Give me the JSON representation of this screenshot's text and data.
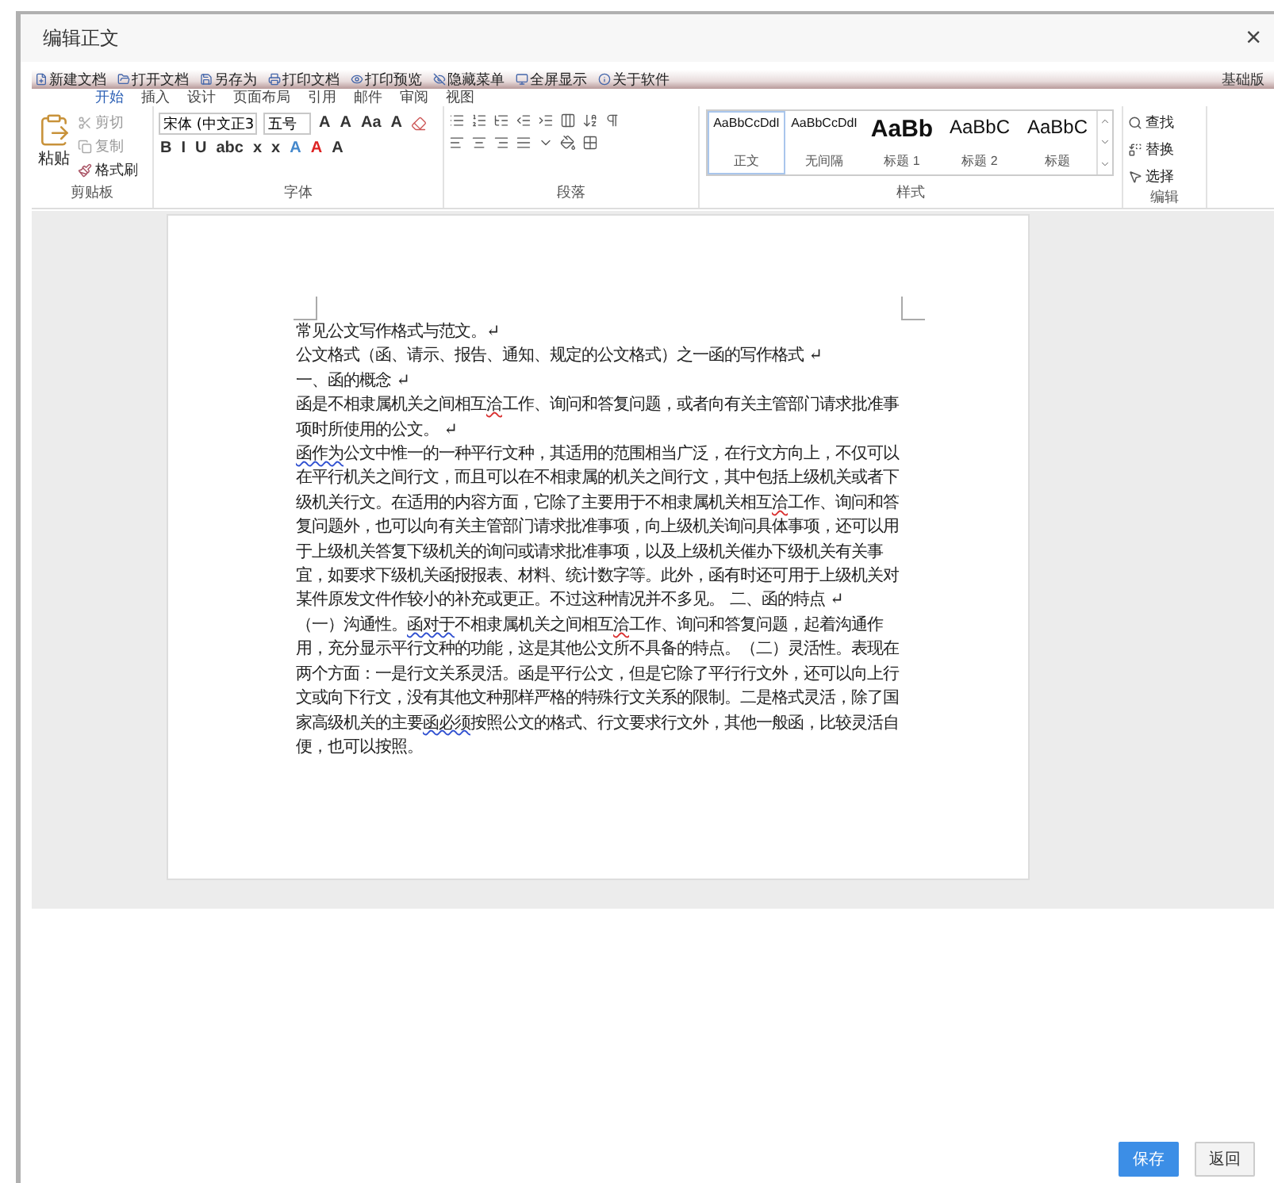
{
  "dialog": {
    "title": "编辑正文",
    "close": "×"
  },
  "quick_toolbar": {
    "items": [
      "新建文档",
      "打开文档",
      "另存为",
      "打印文档",
      "打印预览",
      "隐藏菜单",
      "全屏显示",
      "关于软件"
    ],
    "edition": "基础版"
  },
  "tabs": [
    {
      "label": "开始",
      "selected": true
    },
    {
      "label": "插入",
      "selected": false
    },
    {
      "label": "设计",
      "selected": false
    },
    {
      "label": "页面布局",
      "selected": false
    },
    {
      "label": "引用",
      "selected": false
    },
    {
      "label": "邮件",
      "selected": false
    },
    {
      "label": "审阅",
      "selected": false
    },
    {
      "label": "视图",
      "selected": false
    }
  ],
  "clipboard": {
    "paste": "粘贴",
    "items": [
      {
        "label": "剪切",
        "kind": "cut",
        "disabled": true
      },
      {
        "label": "复制",
        "kind": "copy",
        "disabled": true
      },
      {
        "label": "格式刷",
        "kind": "painter",
        "disabled": false
      }
    ],
    "label": "剪贴板"
  },
  "font": {
    "name": "宋体 (中文正3",
    "size": "五号",
    "row1": [
      "A",
      "A",
      "Aa",
      "A"
    ],
    "row2": [
      "B",
      "I",
      "U",
      "abc",
      "x",
      "x",
      "A",
      "A",
      "A"
    ],
    "label": "字体"
  },
  "paragraph": {
    "label": "段落"
  },
  "styles": {
    "items": [
      {
        "preview": "AaBbCcDdI",
        "name": "正文",
        "kind": "small",
        "selected": true
      },
      {
        "preview": "AaBbCcDdI",
        "name": "无间隔",
        "kind": "small",
        "selected": false
      },
      {
        "preview": "AaBb",
        "name": "标题 1",
        "kind": "heavy",
        "selected": false
      },
      {
        "preview": "AaBbC",
        "name": "标题 2",
        "kind": "medium",
        "selected": false
      },
      {
        "preview": "AaBbC",
        "name": "标题",
        "kind": "medium",
        "selected": false
      }
    ],
    "label": "样式"
  },
  "editing": {
    "items": [
      {
        "label": "查找",
        "kind": "find"
      },
      {
        "label": "替换",
        "kind": "replace"
      },
      {
        "label": "选择",
        "kind": "select"
      }
    ],
    "label": "编辑"
  },
  "document": {
    "paragraphs": [
      [
        {
          "text": "常见公文写作格式与范文。↵",
          "spelling_error": false,
          "grammar_flag": false
        }
      ],
      [
        {
          "text": "公文格式（函、请示、报告、通知、规定的公文格式）之一函的写作格式 ↵",
          "spelling_error": false,
          "grammar_flag": false
        }
      ],
      [
        {
          "text": "一、函的概念 ↵",
          "spelling_error": false,
          "grammar_flag": false
        }
      ],
      [
        {
          "text": "函是不相隶属机关之间相互",
          "spelling_error": false,
          "grammar_flag": false
        },
        {
          "text": "洽",
          "spelling_error": true,
          "grammar_flag": false
        },
        {
          "text": "工作、询问和答复问题，或者向有关主管部门请求批准事项时所使用的公文。 ↵",
          "spelling_error": false,
          "grammar_flag": false
        }
      ],
      [
        {
          "text": "函作为",
          "spelling_error": false,
          "grammar_flag": true
        },
        {
          "text": "公文中惟一的一种平行文种，其适用的范围相当广泛，在行文方向上，不仅可以在平行机关之间行文，而且可以在不相隶属的机关之间行文，其中包括上级机关或者下级机关行文。在适用的内容方面，它除了主要用于不相隶属机关相互",
          "spelling_error": false,
          "grammar_flag": false
        },
        {
          "text": "洽",
          "spelling_error": true,
          "grammar_flag": false
        },
        {
          "text": "工作、询问和答复问题外，也可以向有关主管部门请求批准事项，向上级机关询问具体事项，还可以用于上级机关答复下级机关的询问或请求批准事项，以及上级机关催办下级机关有关事宜，如要求下级机关函报报表、材料、统计数字等。此外，函有时还可用于上级机关对某件原发文件作较小的补充或更正。不过这种情况并不多见。 二、函的特点 ↵",
          "spelling_error": false,
          "grammar_flag": false
        }
      ],
      [
        {
          "text": "（一）沟通性。",
          "spelling_error": false,
          "grammar_flag": false
        },
        {
          "text": "函对于",
          "spelling_error": false,
          "grammar_flag": true
        },
        {
          "text": "不相隶属机关之间相互",
          "spelling_error": false,
          "grammar_flag": false
        },
        {
          "text": "洽",
          "spelling_error": true,
          "grammar_flag": false
        },
        {
          "text": "工作、询问和答复问题，起着沟通作用，充分显示平行文种的功能，这是其他公文所不具备的特点。（二）灵活性。表现在两个方面：一是行文关系灵活。函是平行公文，但是它除了平行行文外，还可以向上行文或向下行文，没有其他文种那样严格的特殊行文关系的限制。二是格式灵活，除了国家高级机关的主要",
          "spelling_error": false,
          "grammar_flag": false
        },
        {
          "text": "函必须",
          "spelling_error": false,
          "grammar_flag": true
        },
        {
          "text": "按照公文的格式、行文要求行文外，其他一般函，比较灵活自便，也可以按照。",
          "spelling_error": false,
          "grammar_flag": false
        }
      ]
    ]
  },
  "buttons": [
    {
      "label": "保存",
      "kind": "primary"
    },
    {
      "label": "返回",
      "kind": "plain"
    }
  ]
}
